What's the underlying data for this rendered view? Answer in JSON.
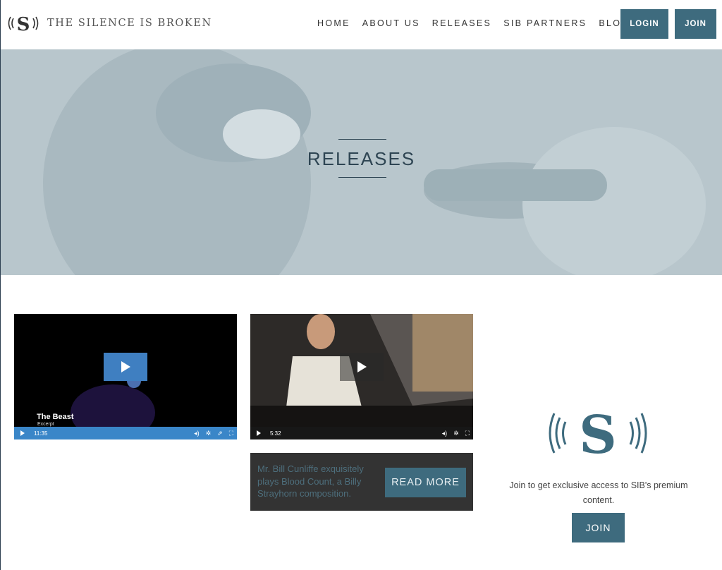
{
  "header": {
    "logo_text": "THE SILENCE IS BROKEN",
    "nav": [
      "HOME",
      "ABOUT US",
      "RELEASES",
      "SIB PARTNERS",
      "BLOG"
    ],
    "login_label": "LOGIN",
    "join_label": "JOIN"
  },
  "hero": {
    "title": "RELEASES"
  },
  "videos": [
    {
      "title": "The Beast",
      "subtitle": "Excerpt",
      "duration": "11:35"
    },
    {
      "title": "",
      "subtitle": "",
      "duration": "5:32"
    }
  ],
  "card": {
    "text": "Mr. Bill Cunliffe exquisitely plays Blood Count, a Billy Strayhorn composition.",
    "button_label": "READ MORE"
  },
  "promo": {
    "text": "Join to get exclusive access to SIB's premium content.",
    "button_label": "JOIN"
  },
  "colors": {
    "accent": "#3e6b7e",
    "hero_bg": "#b8c6cc",
    "video_blue": "#3a86c8"
  }
}
